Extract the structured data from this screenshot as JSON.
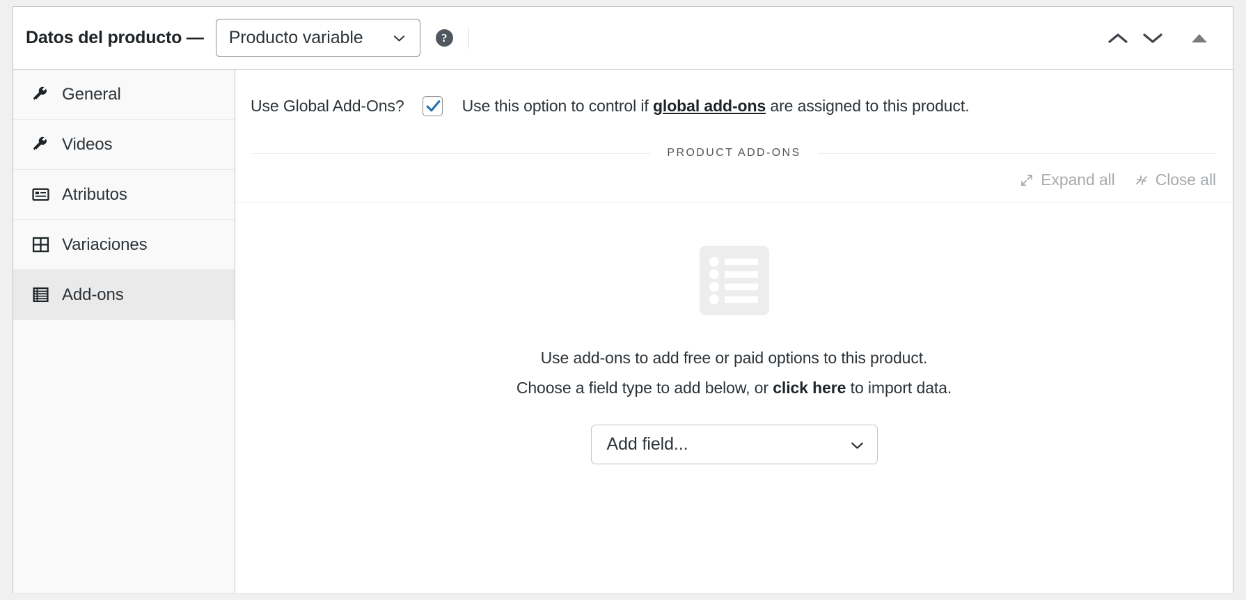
{
  "header": {
    "title": "Datos del producto —",
    "product_type": "Producto variable",
    "help_icon": "question-mark-circle-icon",
    "move_up_icon": "chevron-up-icon",
    "move_down_icon": "chevron-down-icon",
    "collapse_icon": "triangle-up-icon"
  },
  "tabs": [
    {
      "label": "General",
      "icon": "wrench-icon",
      "active": false
    },
    {
      "label": "Videos",
      "icon": "wrench-icon",
      "active": false
    },
    {
      "label": "Atributos",
      "icon": "id-card-icon",
      "active": false
    },
    {
      "label": "Variaciones",
      "icon": "grid-icon",
      "active": false
    },
    {
      "label": "Add-ons",
      "icon": "list-table-icon",
      "active": true
    }
  ],
  "content": {
    "global_addons": {
      "label": "Use Global Add-Ons?",
      "checked": true,
      "description_before": "Use this option to control if ",
      "description_link": "global add-ons",
      "description_after": " are assigned to this product."
    },
    "section_caption": "PRODUCT ADD-ONS",
    "expand_all": "Expand all",
    "close_all": "Close all",
    "expand_icon": "expand-arrows-icon",
    "close_icon": "collapse-arrows-icon",
    "empty_state": {
      "illustration_icon": "list-placeholder-icon",
      "line1": "Use add-ons to add free or paid options to this product.",
      "line2_before": "Choose a field type to add below, or ",
      "line2_link": "click here",
      "line2_after": " to import data."
    },
    "add_field_select": "Add field..."
  },
  "colors": {
    "accent_checkbox": "#2271b1",
    "panel_border": "#c3c4c7",
    "tab_active_bg": "#eaeaea",
    "muted_text": "#a7aaad",
    "empty_icon": "#ededed"
  }
}
